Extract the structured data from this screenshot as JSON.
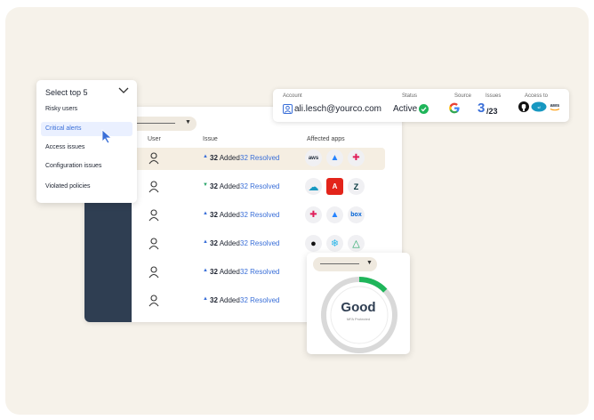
{
  "dropdown": {
    "title": "Select top 5",
    "items": [
      {
        "label": "Risky users"
      },
      {
        "label": "Critical alerts",
        "active": true
      },
      {
        "label": "Access issues"
      },
      {
        "label": "Configuration issues"
      },
      {
        "label": "Violated policies"
      }
    ]
  },
  "table": {
    "columns": {
      "user": "User",
      "issue": "Issue",
      "apps": "Affected apps"
    },
    "rows": [
      {
        "trend": "up",
        "added_count": "32",
        "added_word": "Added",
        "resolved": "32 Resolved",
        "apps": [
          "aws",
          "atlassian",
          "slack"
        ]
      },
      {
        "trend": "down",
        "added_count": "32",
        "added_word": "Added",
        "resolved": "32 Resolved",
        "apps": [
          "salesforce",
          "adobe",
          "zendesk"
        ]
      },
      {
        "trend": "up",
        "added_count": "32",
        "added_word": "Added",
        "resolved": "32 Resolved",
        "apps": [
          "slack",
          "atlassian",
          "box"
        ]
      },
      {
        "trend": "up",
        "added_count": "32",
        "added_word": "Added",
        "resolved": "32 Resolved",
        "apps": [
          "github",
          "snowflake",
          "gdrive"
        ]
      },
      {
        "trend": "up",
        "added_count": "32",
        "added_word": "Added",
        "resolved": "32 Resolved",
        "apps": []
      },
      {
        "trend": "up",
        "added_count": "32",
        "added_word": "Added",
        "resolved": "32 Resolved",
        "apps": []
      }
    ]
  },
  "account": {
    "labels": {
      "account": "Account",
      "status": "Status",
      "source": "Source",
      "issues": "Issues",
      "access": "Access to"
    },
    "email": "ali.lesch@yourco.com",
    "status": "Active",
    "issues_count": "3",
    "issues_total": "/23",
    "source_icon": "google-icon",
    "access_icons": [
      "github-icon",
      "salesforce-icon",
      "aws-icon"
    ]
  },
  "gauge": {
    "label": "Good",
    "sublabel": "MFA Protected",
    "fraction": 0.13,
    "color_active": "#1fb55a",
    "color_track": "#d9d9d9"
  },
  "colors": {
    "accent": "#3a6fd8",
    "sidebar": "#2f3e52",
    "background": "#f6f2ea"
  }
}
